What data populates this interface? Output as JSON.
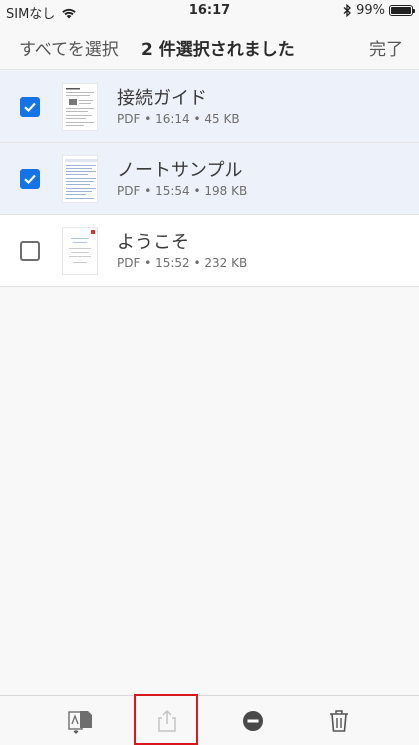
{
  "status": {
    "carrier": "SIMなし",
    "time": "16:17",
    "battery": "99%",
    "battery_level": 0.99
  },
  "nav": {
    "select_all": "すべてを選択",
    "title": "2 件選択されました",
    "done": "完了"
  },
  "files": [
    {
      "name": "接続ガイド",
      "meta": "PDF • 16:14 • 45 KB",
      "selected": true
    },
    {
      "name": "ノートサンプル",
      "meta": "PDF • 15:54 • 198 KB",
      "selected": true
    },
    {
      "name": "ようこそ",
      "meta": "PDF • 15:52 • 232 KB",
      "selected": false
    }
  ],
  "toolbar": {
    "icons": [
      "combine-pdf-icon",
      "share-icon",
      "remove-icon",
      "trash-icon"
    ]
  },
  "colors": {
    "accent": "#1473e6",
    "selected_row": "#edf1f9",
    "highlight": "#d7191e"
  }
}
